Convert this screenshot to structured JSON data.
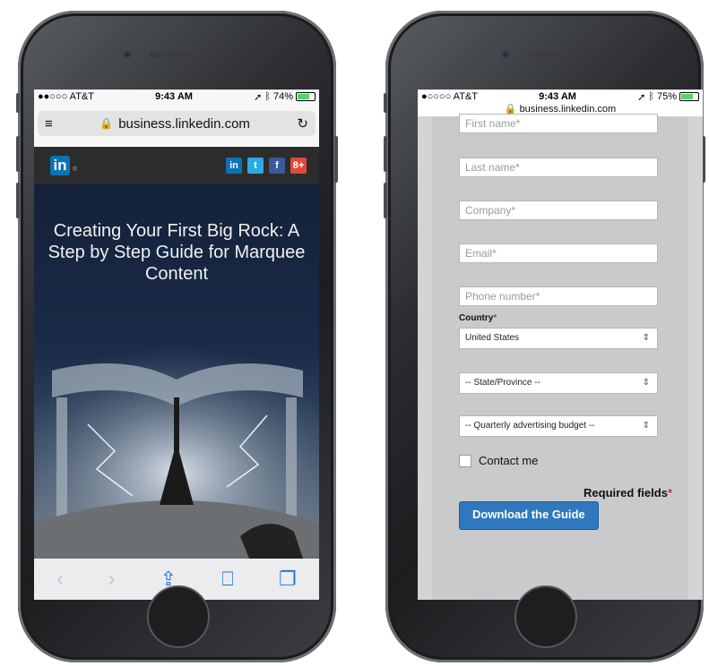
{
  "left_phone": {
    "status": {
      "carrier": "●●○○○ AT&T",
      "time": "9:43 AM",
      "battery": "74%"
    },
    "url": "business.linkedin.com",
    "logo_text": "in",
    "social": [
      "in",
      "t",
      "f",
      "8+"
    ],
    "hero_title": "Creating Your First Big Rock: A Step by Step Guide for Marquee Content",
    "toolbar": [
      "back-icon",
      "forward-icon",
      "share-icon",
      "bookmarks-icon",
      "tabs-icon"
    ]
  },
  "right_phone": {
    "status": {
      "carrier": "●○○○○ AT&T",
      "time": "9:43 AM",
      "battery": "75%"
    },
    "url": "business.linkedin.com",
    "fields": {
      "first_name": "First name*",
      "last_name": "Last name*",
      "company": "Company*",
      "email": "Email*",
      "phone": "Phone number*"
    },
    "country_label": "Country",
    "country_value": "United States",
    "state_value": "-- State/Province --",
    "budget_value": "-- Quarterly advertising budget --",
    "contact_label": "Contact me",
    "required_label": "Required fields",
    "download_button": "Download the Guide"
  },
  "colors": {
    "linkedin_blue": "#0a73b5",
    "button_blue": "#2f78bd",
    "required_red": "#c0392b"
  }
}
